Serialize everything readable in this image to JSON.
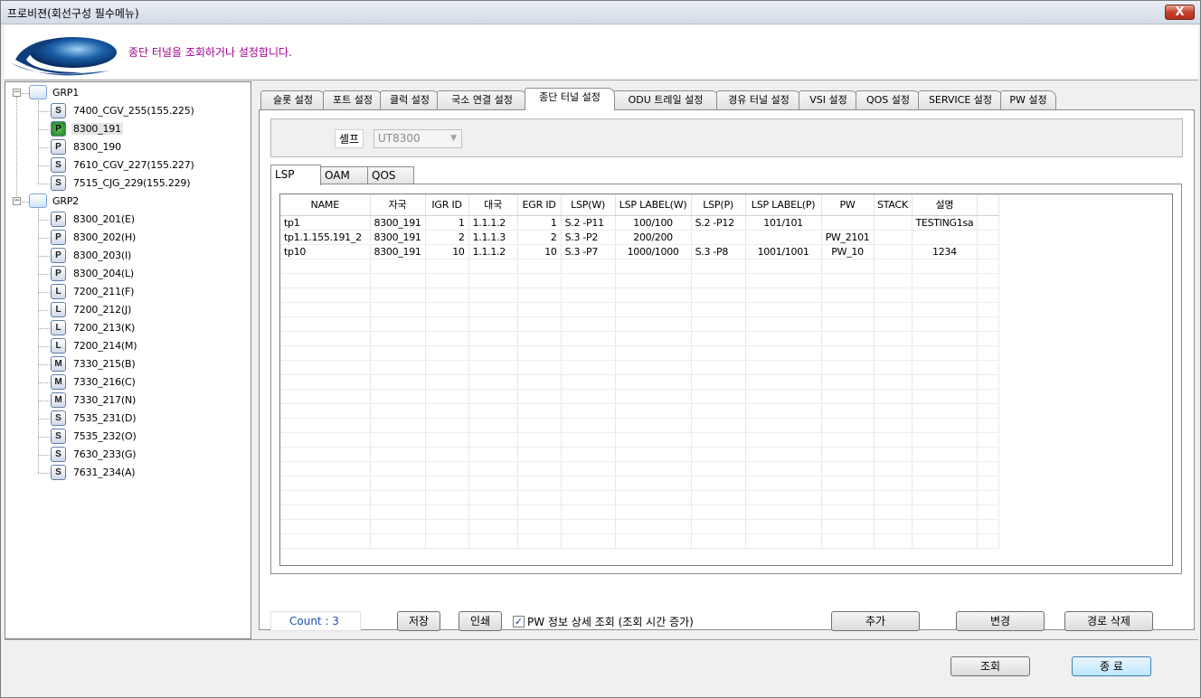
{
  "window": {
    "title": "프로비젼(회선구성 필수메뉴)",
    "close_label": "X"
  },
  "header": {
    "description": "종단 터널을 조회하거나 설정합니다."
  },
  "tree": {
    "groups": [
      {
        "label": "GRP1",
        "nodes": [
          {
            "label": "7400_CGV_255(155.225)",
            "icon": "S"
          },
          {
            "label": "8300_191",
            "icon": "P",
            "selected": true
          },
          {
            "label": "8300_190",
            "icon": "P"
          },
          {
            "label": "7610_CGV_227(155.227)",
            "icon": "S"
          },
          {
            "label": "7515_CJG_229(155.229)",
            "icon": "S"
          }
        ]
      },
      {
        "label": "GRP2",
        "nodes": [
          {
            "label": "8300_201(E)",
            "icon": "P"
          },
          {
            "label": "8300_202(H)",
            "icon": "P"
          },
          {
            "label": "8300_203(I)",
            "icon": "P"
          },
          {
            "label": "8300_204(L)",
            "icon": "P"
          },
          {
            "label": "7200_211(F)",
            "icon": "L"
          },
          {
            "label": "7200_212(J)",
            "icon": "L"
          },
          {
            "label": "7200_213(K)",
            "icon": "L"
          },
          {
            "label": "7200_214(M)",
            "icon": "L"
          },
          {
            "label": "7330_215(B)",
            "icon": "M"
          },
          {
            "label": "7330_216(C)",
            "icon": "M"
          },
          {
            "label": "7330_217(N)",
            "icon": "M"
          },
          {
            "label": "7535_231(D)",
            "icon": "S"
          },
          {
            "label": "7535_232(O)",
            "icon": "S"
          },
          {
            "label": "7630_233(G)",
            "icon": "S"
          },
          {
            "label": "7631_234(A)",
            "icon": "S"
          }
        ]
      }
    ]
  },
  "tabs": [
    "슬롯 설정",
    "포트 설정",
    "클럭 설정",
    "국소 연결 설정",
    "종단 터널 설정",
    "ODU 트레일 설정",
    "경유 터널 설정",
    "VSI 설정",
    "QOS 설정",
    "SERVICE 설정",
    "PW 설정"
  ],
  "active_tab": "종단 터널 설정",
  "shelf": {
    "label": "셸프",
    "value": "UT8300"
  },
  "subtabs": [
    "LSP",
    "OAM",
    "QOS"
  ],
  "active_subtab": "LSP",
  "table": {
    "columns": [
      "NAME",
      "자국",
      "IGR ID",
      "대국",
      "EGR ID",
      "LSP(W)",
      "LSP LABEL(W)",
      "LSP(P)",
      "LSP LABEL(P)",
      "PW",
      "STACK",
      "설명"
    ],
    "rows": [
      [
        "tp1",
        "8300_191",
        "1",
        "1.1.1.2",
        "1",
        "S.2 -P11",
        "100/100",
        "S.2 -P12",
        "101/101",
        "",
        "",
        "TESTING1sa"
      ],
      [
        "tp1.1.155.191_2",
        "8300_191",
        "2",
        "1.1.1.3",
        "2",
        "S.3 -P2",
        "200/200",
        "",
        "",
        "PW_2101",
        "",
        ""
      ],
      [
        "tp10",
        "8300_191",
        "10",
        "1.1.1.2",
        "10",
        "S.3 -P7",
        "1000/1000",
        "S.3 -P8",
        "1001/1001",
        "PW_10",
        "",
        "1234"
      ]
    ]
  },
  "bottom": {
    "count_text": "Count : 3",
    "save_label": "저장",
    "print_label": "인쇄",
    "pw_detail_label": "PW 정보 상세 조회 (조회 시간 증가)",
    "pw_detail_checked": true,
    "add_label": "추가",
    "modify_label": "변경",
    "delete_route_label": "경로 삭제"
  },
  "footer": {
    "query_label": "조회",
    "exit_label": "종 료"
  }
}
